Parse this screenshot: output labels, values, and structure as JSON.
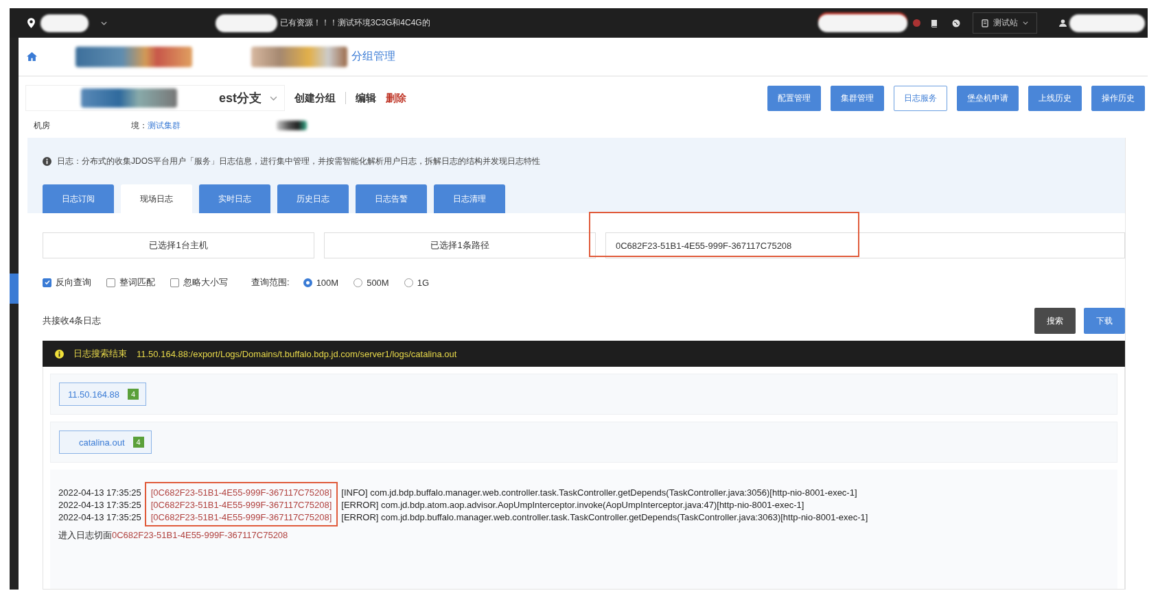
{
  "header": {
    "notice": "已有资源！！！测试环境3C3G和4C4G的",
    "site": "测试站",
    "alert": true
  },
  "breadcrumb": {
    "current": "分组管理"
  },
  "group_select": {
    "value": "est分支"
  },
  "group_actions": [
    {
      "label": "创建分组",
      "kind": "normal"
    },
    {
      "label": "编辑",
      "kind": "normal"
    },
    {
      "label": "删除",
      "kind": "danger"
    }
  ],
  "nav_buttons": [
    {
      "label": "配置管理",
      "selected": false
    },
    {
      "label": "集群管理",
      "selected": false
    },
    {
      "label": "日志服务",
      "selected": true
    },
    {
      "label": "堡垒机申请",
      "selected": false
    },
    {
      "label": "上线历史",
      "selected": false
    },
    {
      "label": "操作历史",
      "selected": false
    }
  ],
  "info_row": {
    "room_label": "机房",
    "env_label": "境：",
    "env_link": "测试集群"
  },
  "notice": "日志：分布式的收集JDOS平台用户「服务」日志信息，进行集中管理，并按需智能化解析用户日志，拆解日志的结构并发现日志特性",
  "tabs": [
    {
      "label": "日志订阅",
      "selected": false
    },
    {
      "label": "现场日志",
      "selected": true
    },
    {
      "label": "实时日志",
      "selected": false
    },
    {
      "label": "历史日志",
      "selected": false
    },
    {
      "label": "日志告警",
      "selected": false
    },
    {
      "label": "日志清理",
      "selected": false
    }
  ],
  "selectors": [
    {
      "label": "已选择1台主机"
    },
    {
      "label": "已选择1条路径"
    }
  ],
  "query": {
    "value": "0C682F23-51B1-4E55-999F-367117C75208",
    "highlighted": true
  },
  "options": [
    {
      "label": "反向查询",
      "checked": true
    },
    {
      "label": "整词匹配",
      "checked": false
    },
    {
      "label": "忽略大小写",
      "checked": false
    }
  ],
  "range": {
    "label": "查询范围:",
    "choices": [
      {
        "label": "100M",
        "selected": true
      },
      {
        "label": "500M",
        "selected": false
      },
      {
        "label": "1G",
        "selected": false
      }
    ]
  },
  "result_count": "共接收4条日志",
  "actions": [
    {
      "label": "搜索",
      "kind": "dark"
    },
    {
      "label": "下载",
      "kind": "primary"
    }
  ],
  "status_bar": {
    "title": "日志搜索结束",
    "path": "11.50.164.88:/export/Logs/Domains/t.buffalo.bdp.jd.com/server1/logs/catalina.out"
  },
  "hosts": [
    {
      "label": "11.50.164.88",
      "count": "4"
    }
  ],
  "files": [
    {
      "label": "catalina.out",
      "count": "4"
    }
  ],
  "log": {
    "traces_highlighted": true,
    "lines": [
      {
        "time": "2022-04-13 17:35:25",
        "trace": "[0C682F23-51B1-4E55-999F-367117C75208]",
        "message": "[INFO] com.jd.bdp.buffalo.manager.web.controller.task.TaskController.getDepends(TaskController.java:3056)[http-nio-8001-exec-1]"
      },
      {
        "time": "2022-04-13 17:35:25",
        "trace": "[0C682F23-51B1-4E55-999F-367117C75208]",
        "message": "[ERROR] com.jd.bdp.atom.aop.advisor.AopUmpInterceptor.invoke(AopUmpInterceptor.java:47)[http-nio-8001-exec-1]"
      },
      {
        "time": "2022-04-13 17:35:25",
        "trace": "[0C682F23-51B1-4E55-999F-367117C75208]",
        "message": "[ERROR] com.jd.bdp.buffalo.manager.web.controller.task.TaskController.getDepends(TaskController.java:3063)[http-nio-8001-exec-1]"
      }
    ],
    "footer": {
      "prefix": "进入日志切面",
      "trace": "0C682F23-51B1-4E55-999F-367117C75208"
    }
  }
}
